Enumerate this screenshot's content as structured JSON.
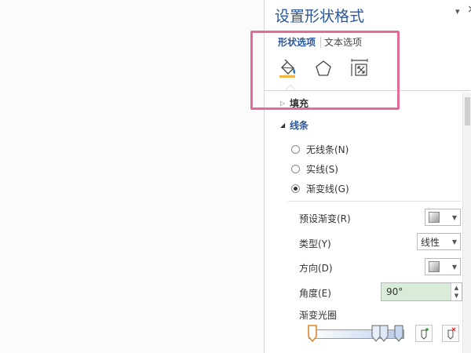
{
  "pane": {
    "title": "设置形状格式",
    "menu_glyph": "▾",
    "close_glyph": "×",
    "tabs": [
      {
        "label": "形状选项",
        "active": true
      },
      {
        "label": "文本选项",
        "active": false
      }
    ],
    "category_icons": [
      "fill-line-icon",
      "effects-pentagon-icon",
      "size-properties-icon"
    ]
  },
  "sections": {
    "fill": {
      "label": "填充",
      "expanded": false,
      "arrow": "▷"
    },
    "line": {
      "label": "线条",
      "expanded": true,
      "arrow": "◢"
    }
  },
  "line_options": {
    "radios": [
      {
        "label": "无线条(N)",
        "checked": false
      },
      {
        "label": "实线(S)",
        "checked": false
      },
      {
        "label": "渐变线(G)",
        "checked": true
      }
    ]
  },
  "gradient": {
    "preset_label": "预设渐变(R)",
    "type_label": "类型(Y)",
    "type_value": "线性",
    "direction_label": "方向(D)",
    "angle_label": "角度(E)",
    "angle_value": "90°",
    "stops_label": "渐变光圈"
  },
  "colors": {
    "accent": "#2b579a",
    "highlight_border": "#e46a9a",
    "angle_bg": "#d9ecd9",
    "stop_selected": "#e0872d"
  }
}
